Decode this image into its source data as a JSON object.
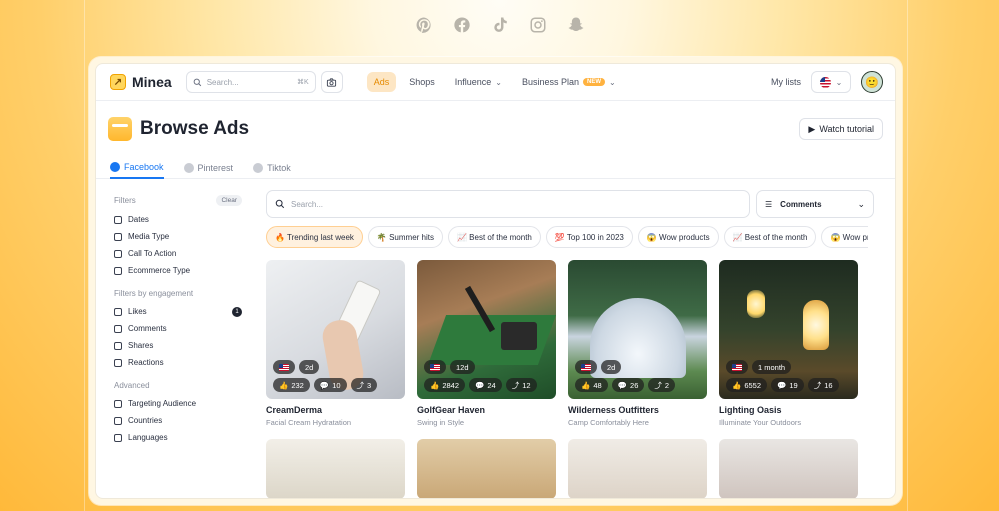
{
  "social_icons": [
    "pinterest-icon",
    "facebook-icon",
    "tiktok-icon",
    "instagram-icon",
    "snapchat-icon"
  ],
  "topnav": {
    "logo": "Minea",
    "search_placeholder": "Search...",
    "shortcut": "⌘K",
    "links": [
      {
        "label": "Ads",
        "active": true
      },
      {
        "label": "Shops"
      },
      {
        "label": "Influence"
      },
      {
        "label": "Business Plan",
        "badge": "NEW"
      }
    ],
    "my_lists": "My lists"
  },
  "header": {
    "title": "Browse Ads",
    "watch_tutorial": "Watch tutorial"
  },
  "tabs": [
    {
      "label": "Facebook",
      "active": true
    },
    {
      "label": "Pinterest"
    },
    {
      "label": "Tiktok"
    }
  ],
  "sidebar": {
    "filters_title": "Filters",
    "clear": "Clear",
    "filters": [
      "Dates",
      "Media Type",
      "Call To Action",
      "Ecommerce Type"
    ],
    "engagement_title": "Filters by engagement",
    "engagement": [
      "Likes",
      "Comments",
      "Shares",
      "Reactions"
    ],
    "likes_count": "1",
    "advanced_title": "Advanced",
    "advanced": [
      "Targeting Audience",
      "Countries",
      "Languages"
    ]
  },
  "main": {
    "search_placeholder": "Search...",
    "sort_label": "Comments",
    "chips": [
      {
        "label": "🔥 Trending last week",
        "active": true
      },
      {
        "label": "🌴 Summer hits"
      },
      {
        "label": "📈 Best of the month"
      },
      {
        "label": "💯 Top 100 in 2023"
      },
      {
        "label": "😱 Wow products"
      },
      {
        "label": "📈 Best of the month"
      },
      {
        "label": "😱 Wow products"
      }
    ]
  },
  "cards": [
    {
      "age": "2d",
      "likes": "232",
      "comments": "10",
      "shares": "3",
      "name": "CreamDerma",
      "tagline": "Facial Cream Hydratation"
    },
    {
      "age": "12d",
      "likes": "2842",
      "comments": "24",
      "shares": "12",
      "name": "GolfGear Haven",
      "tagline": "Swing in Style"
    },
    {
      "age": "2d",
      "likes": "48",
      "comments": "26",
      "shares": "2",
      "name": "Wilderness Outfitters",
      "tagline": "Camp Comfortably Here"
    },
    {
      "age": "1 month",
      "likes": "6552",
      "comments": "19",
      "shares": "16",
      "name": "Lighting Oasis",
      "tagline": "Illuminate Your Outdoors"
    }
  ]
}
